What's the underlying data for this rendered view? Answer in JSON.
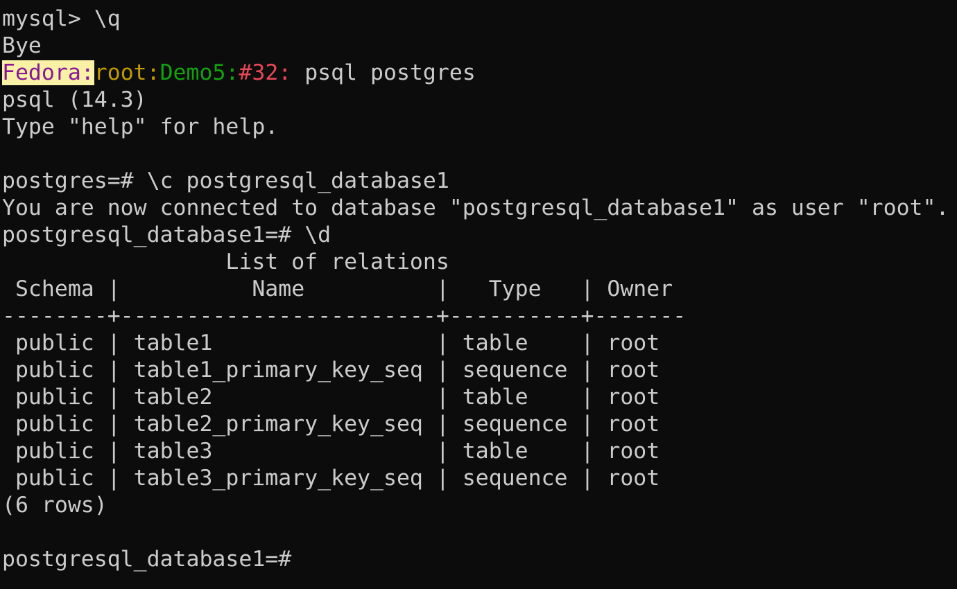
{
  "terminal": {
    "lines": [
      "mysql> \\q",
      "Bye",
      "",
      "psql (14.3)",
      "Type \"help\" for help.",
      "",
      "postgres=# \\c postgresql_database1",
      "You are now connected to database \"postgresql_database1\" as user \"root\".",
      "postgresql_database1=# \\d",
      "                 List of relations"
    ],
    "prompt": {
      "host": "Fedora:",
      "user": "root:",
      "dir": "Demo5:",
      "num": "#32:",
      "command": " psql postgres"
    },
    "table": {
      "header": " Schema |          Name          |   Type   | Owner",
      "divider": "--------+------------------------+----------+-------",
      "rows": [
        {
          "schema": "public",
          "name": "table1",
          "type": "table",
          "owner": "root"
        },
        {
          "schema": "public",
          "name": "table1_primary_key_seq",
          "type": "sequence",
          "owner": "root"
        },
        {
          "schema": "public",
          "name": "table2",
          "type": "table",
          "owner": "root"
        },
        {
          "schema": "public",
          "name": "table2_primary_key_seq",
          "type": "sequence",
          "owner": "root"
        },
        {
          "schema": "public",
          "name": "table3",
          "type": "table",
          "owner": "root"
        },
        {
          "schema": "public",
          "name": "table3_primary_key_seq",
          "type": "sequence",
          "owner": "root"
        }
      ],
      "row_text": [
        " public | table1                 | table    | root",
        " public | table1_primary_key_seq | sequence | root",
        " public | table2                 | table    | root",
        " public | table2_primary_key_seq | sequence | root",
        " public | table3                 | table    | root",
        " public | table3_primary_key_seq | sequence | root"
      ],
      "footer": "(6 rows)"
    },
    "final_prompt": "postgresql_database1=# ",
    "colors": {
      "background": "#0c0c0c",
      "foreground": "#cccccc",
      "host_bg": "#f9f1a5",
      "host_fg": "#881798",
      "user": "#c19c00",
      "dir": "#13a10e",
      "num": "#e74856"
    }
  }
}
